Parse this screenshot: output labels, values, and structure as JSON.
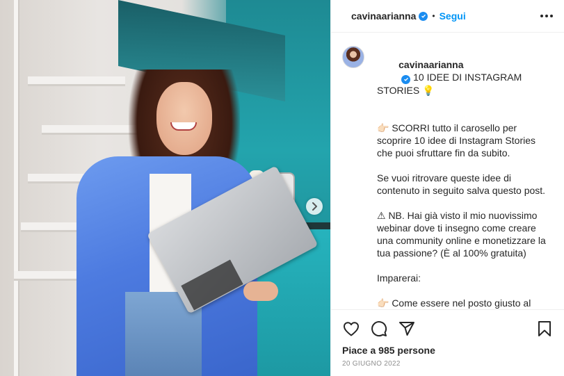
{
  "post": {
    "username": "cavinaarianna",
    "follow_label": "Segui",
    "separator_dot": "•"
  },
  "caption": {
    "username": "cavinaarianna",
    "lines": [
      "10 IDEE DI INSTAGRAM STORIES 💡",
      "⠀⠀⠀⠀⠀⠀⠀⠀⠀⠀⠀⠀",
      "👉🏻 SCORRI tutto il carosello per scoprire 10 idee di Instagram Stories che puoi sfruttare fin da subito.",
      "⠀⠀⠀⠀⠀⠀⠀⠀⠀⠀⠀⠀",
      "Se vuoi ritrovare queste idee di contenuto in seguito salva questo post.",
      "⠀⠀⠀⠀⠀⠀⠀⠀⠀⠀⠀⠀",
      "⚠ NB. Hai già visto il mio nuovissimo webinar dove ti insegno come creare una community online e monetizzare la tua passione? (È al 100% gratuita)",
      "⠀⠀⠀⠀⠀⠀⠀⠀⠀⠀⠀⠀",
      "Imparerai:",
      "⠀⠀⠀⠀⠀⠀⠀⠀⠀⠀⠀⠀",
      "👉🏻 Come essere nel posto giusto al momento giusto, ossia come trovare la tua nicchia."
    ]
  },
  "stats": {
    "likes_text": "Piace a 985 persone",
    "date_text": "20 GIUGNO 2022"
  },
  "icons": {
    "verified": "verified-badge-icon",
    "more": "more-options-icon",
    "like": "heart-icon",
    "comment": "comment-icon",
    "share": "share-icon",
    "save": "bookmark-icon",
    "next": "chevron-right-icon"
  },
  "colors": {
    "accent": "#0095f6",
    "verified": "#1a8cf0",
    "text": "#262626",
    "muted": "#8e8e8e"
  }
}
